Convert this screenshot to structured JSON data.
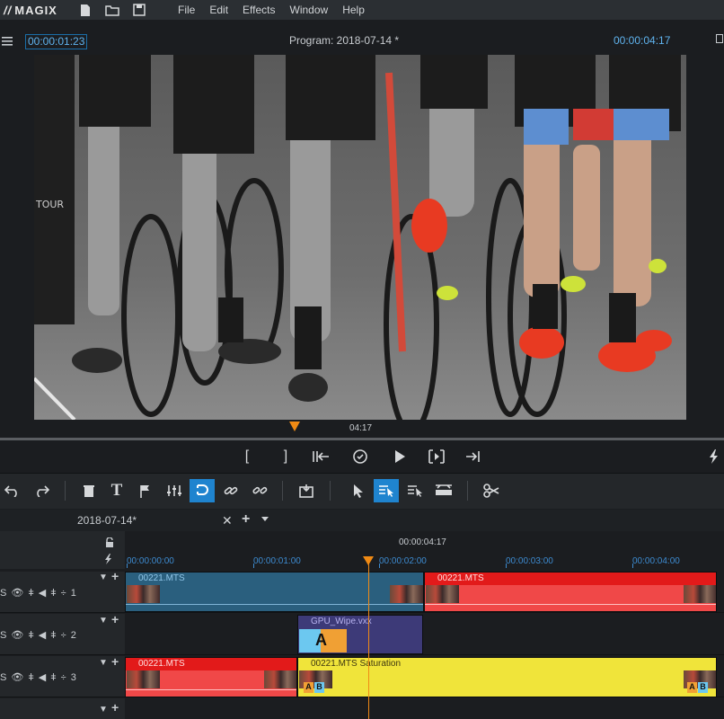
{
  "app": {
    "logo": "MAGIX"
  },
  "menu": [
    "File",
    "Edit",
    "Effects",
    "Window",
    "Help"
  ],
  "monitor": {
    "timecode_position": "00:00:01:23",
    "title": "Program: 2018-07-14 *",
    "timecode_duration": "00:00:04:17",
    "scrub_label": "04:17"
  },
  "transport": {
    "buttons": [
      "[",
      "]",
      "go-to-start",
      "loop",
      "play",
      "step",
      "go-to-end"
    ]
  },
  "timeline": {
    "tab": "2018-07-14*",
    "ruler_time": "00:00:04:17",
    "ruler_ticks": [
      "00:00:00:00",
      "00:00:01:00",
      "00:00:02:00",
      "00:00:03:00",
      "00:00:04:00"
    ],
    "tracks": [
      {
        "number": "1"
      },
      {
        "number": "2"
      },
      {
        "number": "3"
      }
    ],
    "clips": {
      "t1a": "00221.MTS",
      "t1b": "00221.MTS",
      "t2a": "GPU_Wipe.vxx",
      "t3a": "00221.MTS",
      "t3b": "00221.MTS   Saturation"
    }
  },
  "colors": {
    "accent": "#1f84cf",
    "timecode": "#5fb3ee",
    "playhead": "#f08a14",
    "clip_blue": "#2a5f7e",
    "clip_red": "#f04848",
    "clip_yellow": "#f0e43a",
    "clip_purple": "#3d3a78"
  }
}
